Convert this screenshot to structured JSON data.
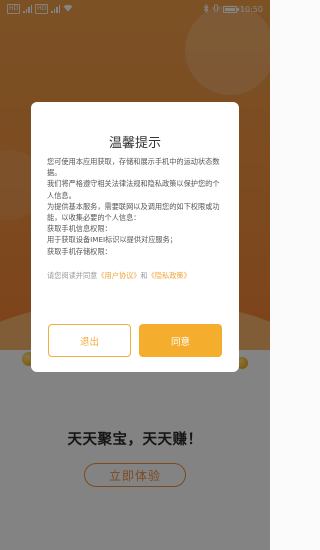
{
  "status_bar": {
    "sim1": "HD",
    "sim2": "HD",
    "battery_percent": 100,
    "time": "10:50"
  },
  "app": {
    "slogan": "天天聚宝，天天赚！",
    "experience_button": "立即体验"
  },
  "dialog": {
    "title": "温馨提示",
    "paragraphs": [
      "您可使用本应用获取，存储和展示手机中的运动状态数据。",
      "我们将严格遵守相关法律法规和隐私政策以保护您的个人信息。",
      "为提供基本服务，需要联网以及调用您的如下权限或功能，以收集必要的个人信息：",
      "获取手机信息权限：",
      "用于获取设备IMEI标识以提供对应服务；",
      "获取手机存储权限："
    ],
    "agree_prefix": "请您阅读并同意",
    "user_agreement_link": "《用户协议》",
    "agree_and": "和",
    "privacy_policy_link": "《隐私政策》",
    "exit_button": "退出",
    "agree_button": "同意"
  },
  "colors": {
    "accent": "#f5ad2e",
    "header_orange": "#ef8f3d",
    "link": "#f0a43a"
  }
}
